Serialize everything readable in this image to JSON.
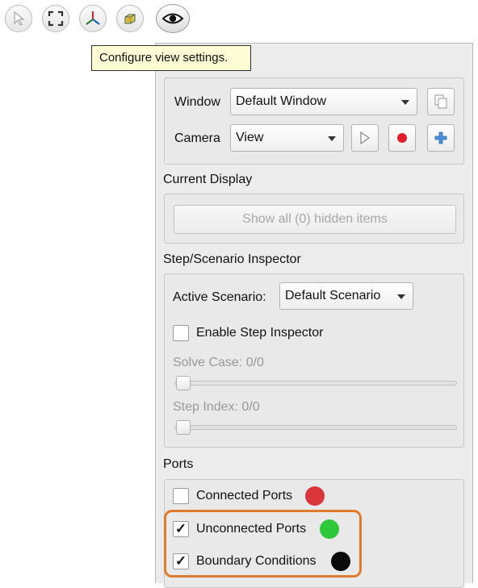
{
  "toolbar": {
    "buttons": [
      {
        "name": "select-arrow-icon"
      },
      {
        "name": "fit-view-icon"
      },
      {
        "name": "axes-triad-icon"
      },
      {
        "name": "shaded-cube-icon"
      },
      {
        "name": "eye-icon"
      }
    ]
  },
  "tooltip": {
    "text": "Configure view settings."
  },
  "view": {
    "window_label": "Window",
    "window_value": "Default Window",
    "camera_label": "Camera",
    "camera_value": "View"
  },
  "current_display": {
    "title": "Current Display",
    "show_hidden_label": "Show all (0) hidden items"
  },
  "inspector": {
    "title": "Step/Scenario Inspector",
    "active_scenario_label": "Active Scenario:",
    "active_scenario_value": "Default Scenario",
    "enable_label": "Enable Step Inspector",
    "enable_checked": false,
    "solve_case_label": "Solve Case: 0/0",
    "step_index_label": "Step Index: 0/0"
  },
  "ports": {
    "title": "Ports",
    "items": [
      {
        "label": "Connected Ports",
        "checked": false,
        "color": "#d9363b"
      },
      {
        "label": "Unconnected Ports",
        "checked": true,
        "color": "#2ec83a"
      },
      {
        "label": "Boundary Conditions",
        "checked": true,
        "color": "#0a0a0a"
      }
    ]
  },
  "colors": {
    "accent_highlight": "#e07b2c"
  }
}
